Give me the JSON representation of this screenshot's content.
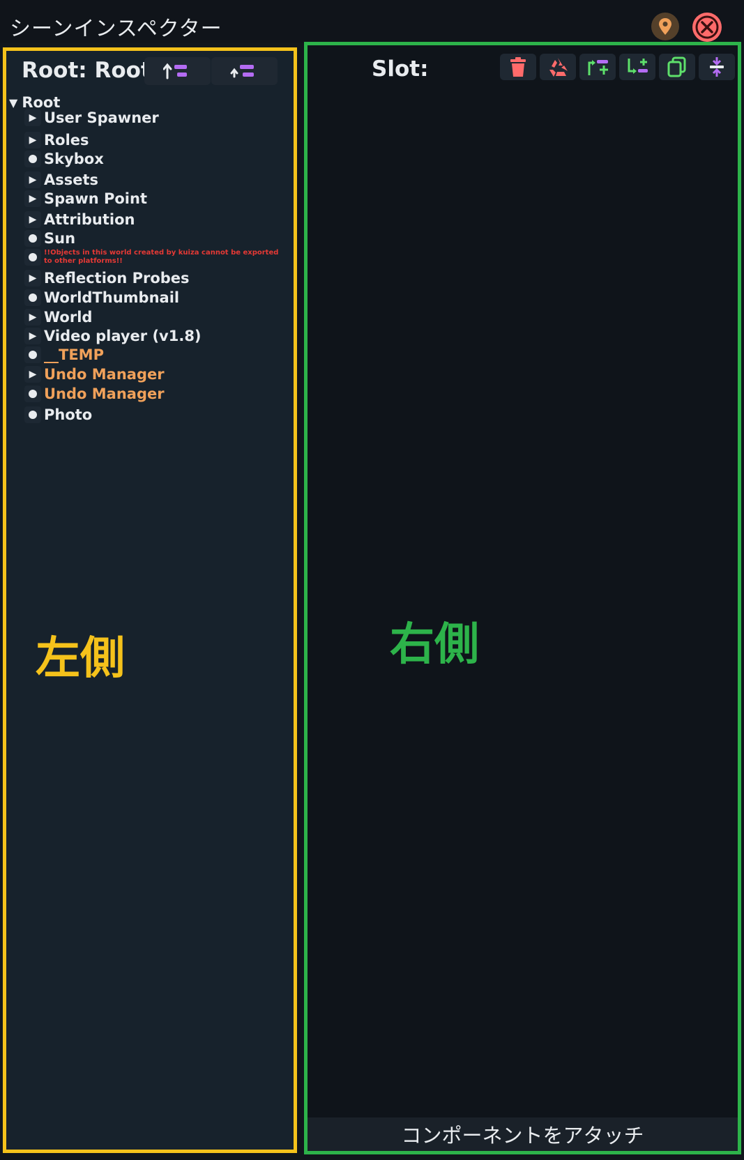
{
  "window": {
    "title": "シーンインスペクター"
  },
  "titlebar_buttons": {
    "pin_icon": "location-pin-icon",
    "close_icon": "close-icon"
  },
  "left": {
    "root_title": "Root: Root",
    "buttons": [
      {
        "icon": "move-up-icon"
      },
      {
        "icon": "move-to-parent-icon"
      }
    ],
    "tree_root": "Root",
    "items": [
      {
        "label": "User Spawner",
        "kind": "expand",
        "color": "white"
      },
      {
        "label": "Roles",
        "kind": "expand",
        "color": "white"
      },
      {
        "label": "Skybox",
        "kind": "leaf",
        "color": "white"
      },
      {
        "label": "Assets",
        "kind": "expand",
        "color": "white"
      },
      {
        "label": "Spawn Point",
        "kind": "expand",
        "color": "white"
      },
      {
        "label": "Attribution",
        "kind": "expand",
        "color": "white"
      },
      {
        "label": "Sun",
        "kind": "leaf",
        "color": "white"
      },
      {
        "label": "!!Objects in this world created by kuiza cannot be exported to other platforms!!",
        "kind": "leaf",
        "color": "warn"
      },
      {
        "label": "Reflection Probes",
        "kind": "expand",
        "color": "white"
      },
      {
        "label": "WorldThumbnail",
        "kind": "leaf",
        "color": "white"
      },
      {
        "label": "World",
        "kind": "expand",
        "color": "white"
      },
      {
        "label": "Video player (v1.8)",
        "kind": "expand",
        "color": "white"
      },
      {
        "label": "__TEMP",
        "kind": "leaf",
        "color": "orange"
      },
      {
        "label": "Undo Manager",
        "kind": "expand",
        "color": "orange"
      },
      {
        "label": "Undo Manager",
        "kind": "leaf",
        "color": "orange"
      },
      {
        "label": "Photo",
        "kind": "leaf",
        "color": "white"
      }
    ],
    "caption": "左側"
  },
  "right": {
    "slot_label": "Slot:",
    "tools": [
      {
        "icon": "trash-icon"
      },
      {
        "icon": "recycle-icon"
      },
      {
        "icon": "insert-parent-icon"
      },
      {
        "icon": "add-child-icon"
      },
      {
        "icon": "duplicate-icon"
      },
      {
        "icon": "center-icon"
      }
    ],
    "caption": "右側",
    "attach_label": "コンポーネントをアタッチ"
  },
  "colors": {
    "left_border": "#f5c21b",
    "right_border": "#2db34a",
    "orange_text": "#f0a15a",
    "warn_text": "#e53935",
    "close_red": "#ff6b6b",
    "purple_icon": "#b46cf3",
    "green_icon": "#5ee06b"
  }
}
